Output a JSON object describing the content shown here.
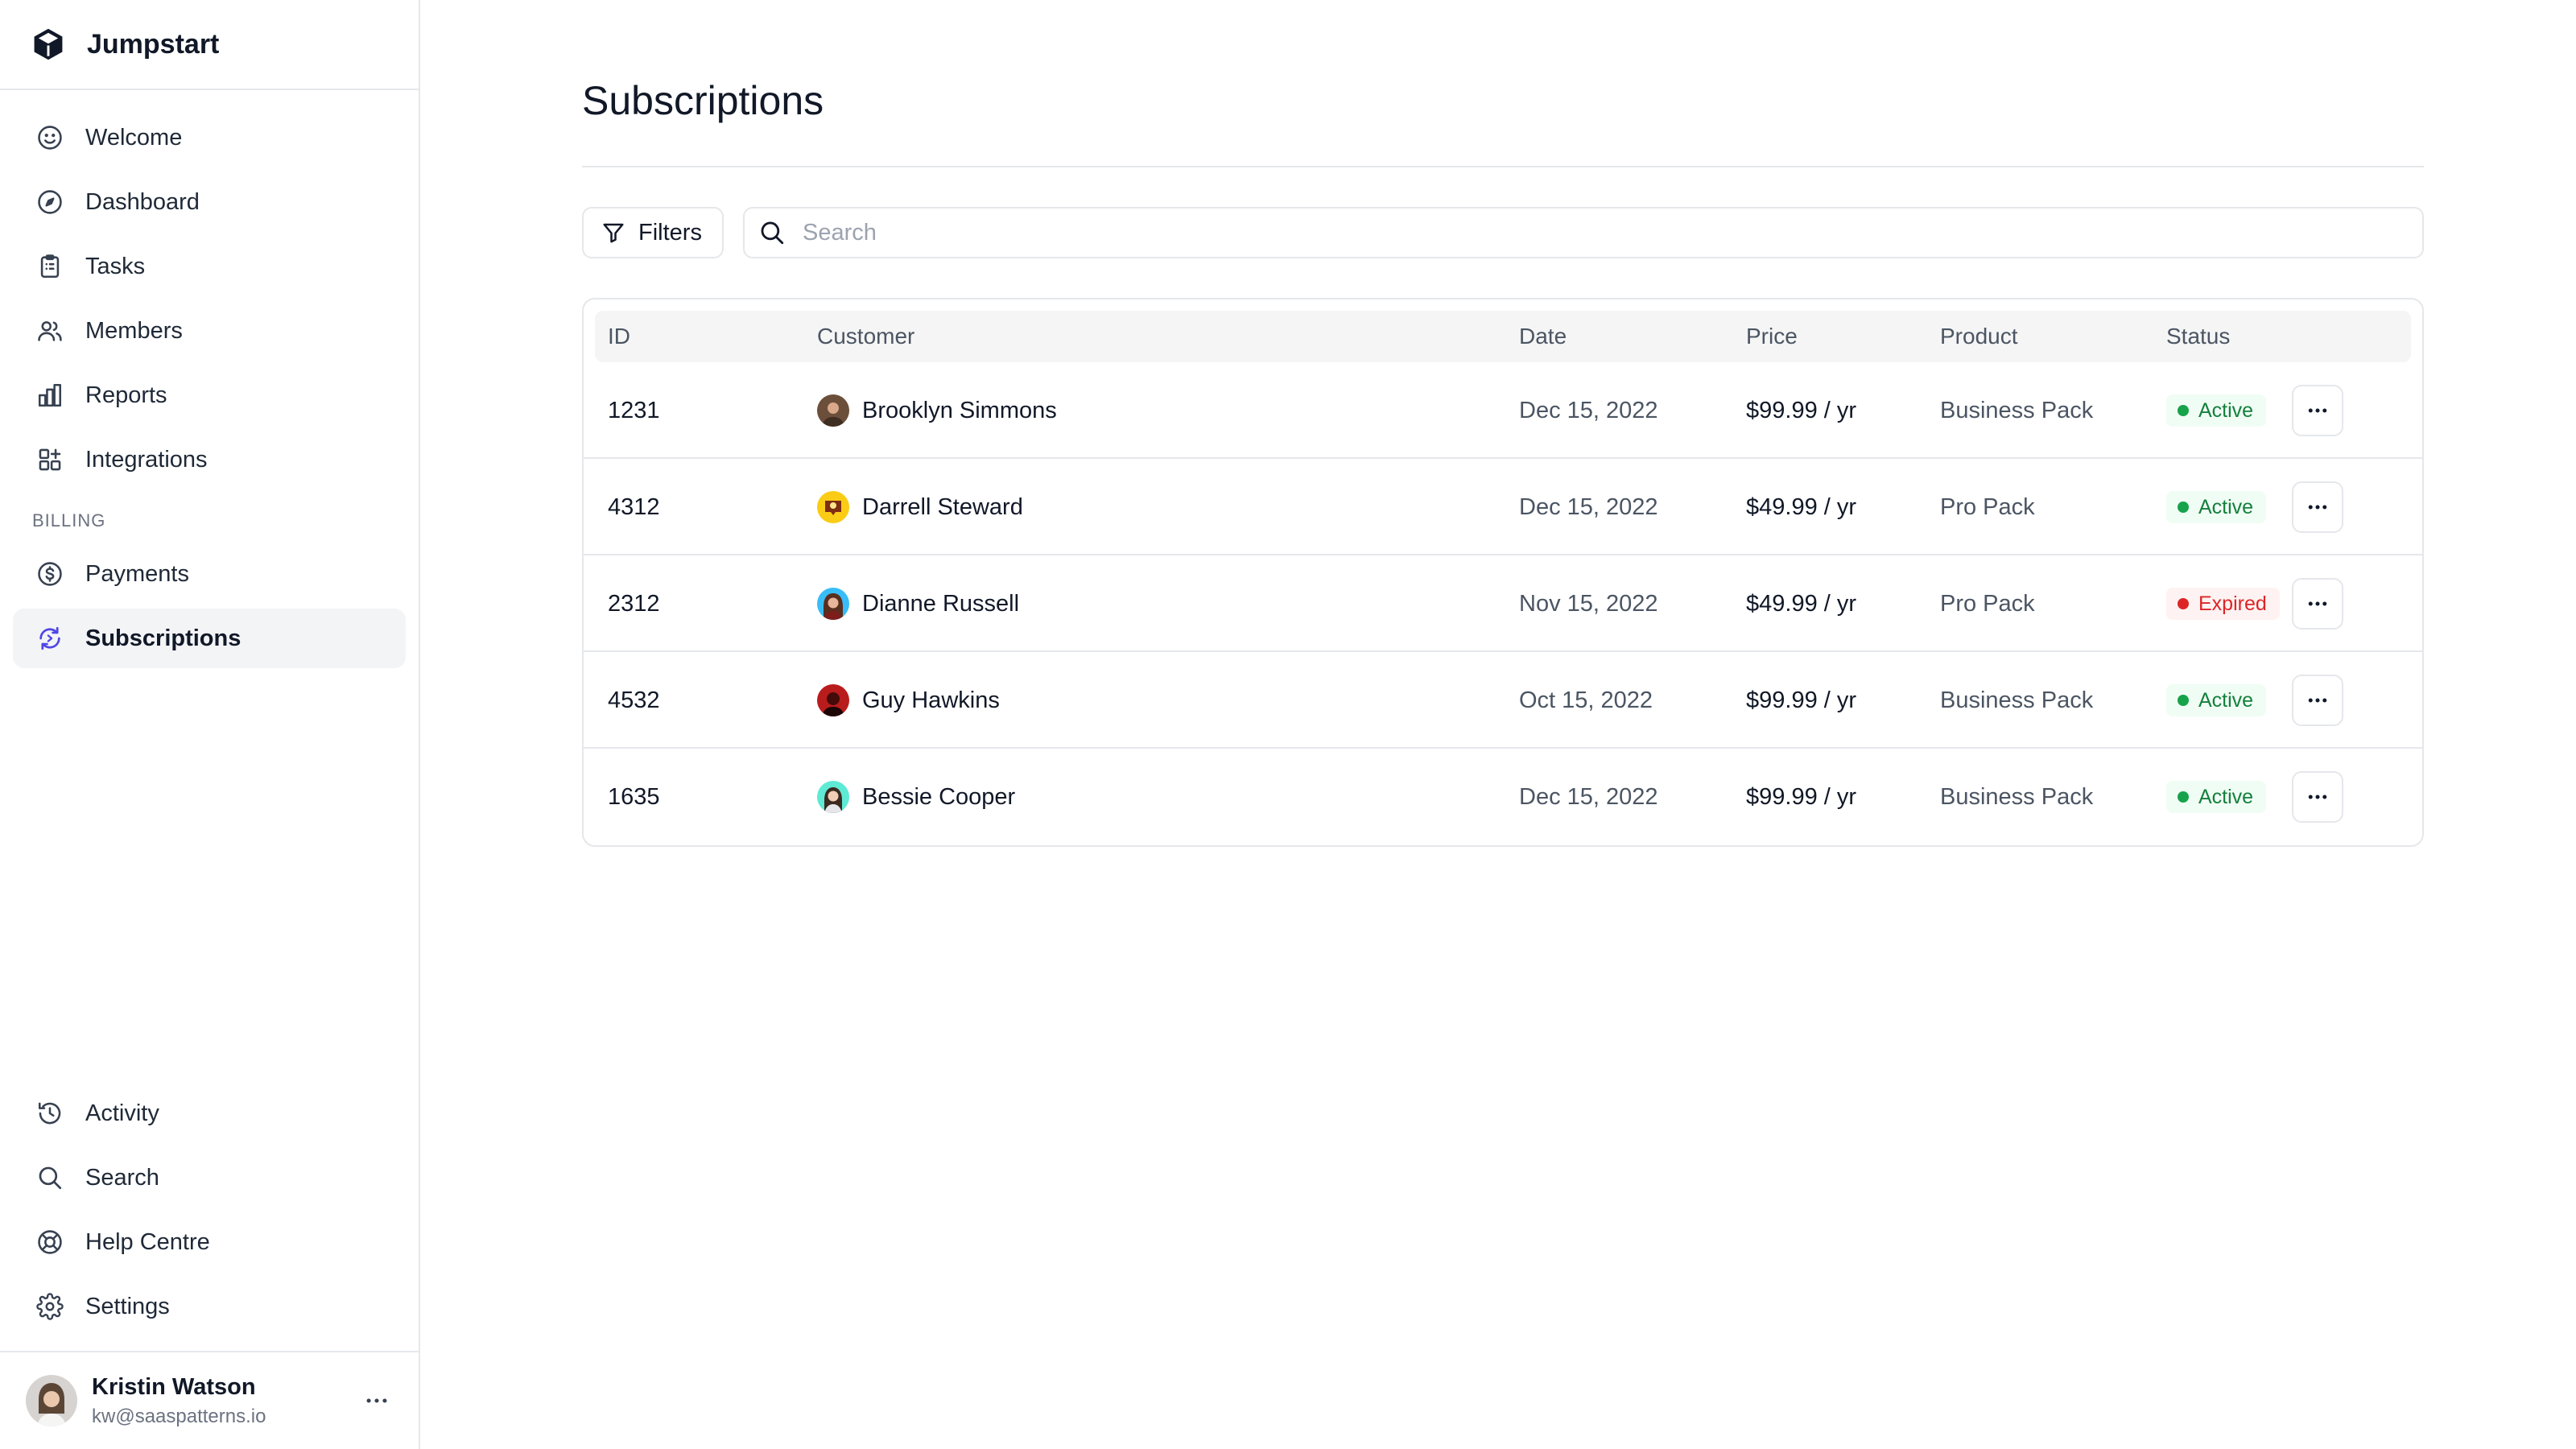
{
  "app": {
    "name": "Jumpstart"
  },
  "sidebar": {
    "primary": [
      {
        "label": "Welcome",
        "icon": "smile-icon"
      },
      {
        "label": "Dashboard",
        "icon": "compass-icon"
      },
      {
        "label": "Tasks",
        "icon": "clipboard-icon"
      },
      {
        "label": "Members",
        "icon": "users-icon"
      },
      {
        "label": "Reports",
        "icon": "bar-chart-icon"
      },
      {
        "label": "Integrations",
        "icon": "grid-plus-icon"
      }
    ],
    "billing_label": "BILLING",
    "billing": [
      {
        "label": "Payments",
        "icon": "dollar-circle-icon"
      },
      {
        "label": "Subscriptions",
        "icon": "refresh-icon",
        "active": true
      }
    ],
    "secondary": [
      {
        "label": "Activity",
        "icon": "history-icon"
      },
      {
        "label": "Search",
        "icon": "search-icon"
      },
      {
        "label": "Help Centre",
        "icon": "lifebuoy-icon"
      },
      {
        "label": "Settings",
        "icon": "gear-icon"
      }
    ],
    "user": {
      "name": "Kristin Watson",
      "email": "kw@saaspatterns.io"
    }
  },
  "main": {
    "title": "Subscriptions",
    "filters_label": "Filters",
    "search_placeholder": "Search",
    "table": {
      "columns": {
        "id": "ID",
        "customer": "Customer",
        "date": "Date",
        "price": "Price",
        "product": "Product",
        "status": "Status"
      },
      "rows": [
        {
          "id": "1231",
          "customer": "Brooklyn Simmons",
          "date": "Dec 15, 2022",
          "price": "$99.99 / yr",
          "product": "Business Pack",
          "status": "Active"
        },
        {
          "id": "4312",
          "customer": "Darrell Steward",
          "date": "Dec 15, 2022",
          "price": "$49.99 / yr",
          "product": "Pro Pack",
          "status": "Active"
        },
        {
          "id": "2312",
          "customer": "Dianne Russell",
          "date": "Nov 15, 2022",
          "price": "$49.99 / yr",
          "product": "Pro Pack",
          "status": "Expired"
        },
        {
          "id": "4532",
          "customer": "Guy Hawkins",
          "date": "Oct 15, 2022",
          "price": "$99.99 / yr",
          "product": "Business Pack",
          "status": "Active"
        },
        {
          "id": "1635",
          "customer": "Bessie Cooper",
          "date": "Dec 15, 2022",
          "price": "$99.99 / yr",
          "product": "Business Pack",
          "status": "Active"
        }
      ]
    }
  },
  "colors": {
    "accent": "#4f46e5",
    "active": "#16a34a",
    "expired": "#dc2626",
    "border": "#e5e7eb"
  }
}
